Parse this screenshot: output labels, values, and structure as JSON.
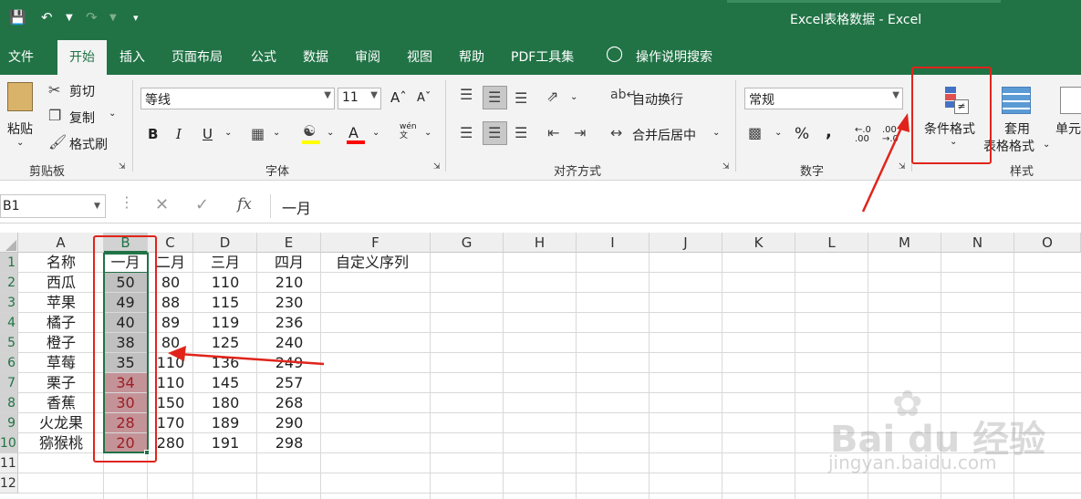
{
  "title": "Excel表格数据  -  Excel",
  "tabs": [
    "文件",
    "开始",
    "插入",
    "页面布局",
    "公式",
    "数据",
    "审阅",
    "视图",
    "帮助",
    "PDF工具集",
    "操作说明搜索"
  ],
  "clipboard": {
    "paste": "粘贴",
    "cut": "剪切",
    "copy": "复制",
    "format_painter": "格式刷",
    "group": "剪贴板"
  },
  "font": {
    "name": "等线",
    "size": "11",
    "bold": "B",
    "italic": "I",
    "underline": "U",
    "group": "字体",
    "phonetic": "wén 文"
  },
  "align": {
    "wrap": "自动换行",
    "merge": "合并后居中",
    "group": "对齐方式"
  },
  "number": {
    "format": "常规",
    "percent": "%",
    "comma": ",",
    "group": "数字"
  },
  "styles": {
    "conditional": "条件格式",
    "table_format_1": "套用",
    "table_format_2": "表格格式",
    "cell_styles": "单元",
    "group": "样式"
  },
  "formula_bar": {
    "name_box": "B1",
    "formula": "一月",
    "fx": "fx"
  },
  "columns": [
    "A",
    "B",
    "C",
    "D",
    "E",
    "F",
    "G",
    "H",
    "I",
    "J",
    "K",
    "L",
    "M",
    "N",
    "O"
  ],
  "rows": [
    "1",
    "2",
    "3",
    "4",
    "5",
    "6",
    "7",
    "8",
    "9",
    "10",
    "11",
    "12"
  ],
  "table": [
    {
      "a": "名称",
      "b": "一月",
      "c": "二月",
      "d": "三月",
      "e": "四月",
      "f": "自定义序列"
    },
    {
      "a": "西瓜",
      "b": "50",
      "c": "80",
      "d": "110",
      "e": "210"
    },
    {
      "a": "苹果",
      "b": "49",
      "c": "88",
      "d": "115",
      "e": "230"
    },
    {
      "a": "橘子",
      "b": "40",
      "c": "89",
      "d": "119",
      "e": "236"
    },
    {
      "a": "橙子",
      "b": "38",
      "c": "80",
      "d": "125",
      "e": "240"
    },
    {
      "a": "草莓",
      "b": "35",
      "c": "110",
      "d": "136",
      "e": "249"
    },
    {
      "a": "栗子",
      "b": "34",
      "c": "110",
      "d": "145",
      "e": "257"
    },
    {
      "a": "香蕉",
      "b": "30",
      "c": "150",
      "d": "180",
      "e": "268"
    },
    {
      "a": "火龙果",
      "b": "28",
      "c": "170",
      "d": "189",
      "e": "290"
    },
    {
      "a": "猕猴桃",
      "b": "20",
      "c": "280",
      "d": "191",
      "e": "298"
    }
  ],
  "colors": {
    "excel_green": "#217346",
    "gray_fill": "#c0c0c0",
    "red_fill": "#c49398",
    "red_text": "#9c1f24",
    "annotation": "#e0241b"
  },
  "watermark": {
    "logo": "Bai du 经验",
    "url": "jingyan.baidu.com"
  }
}
